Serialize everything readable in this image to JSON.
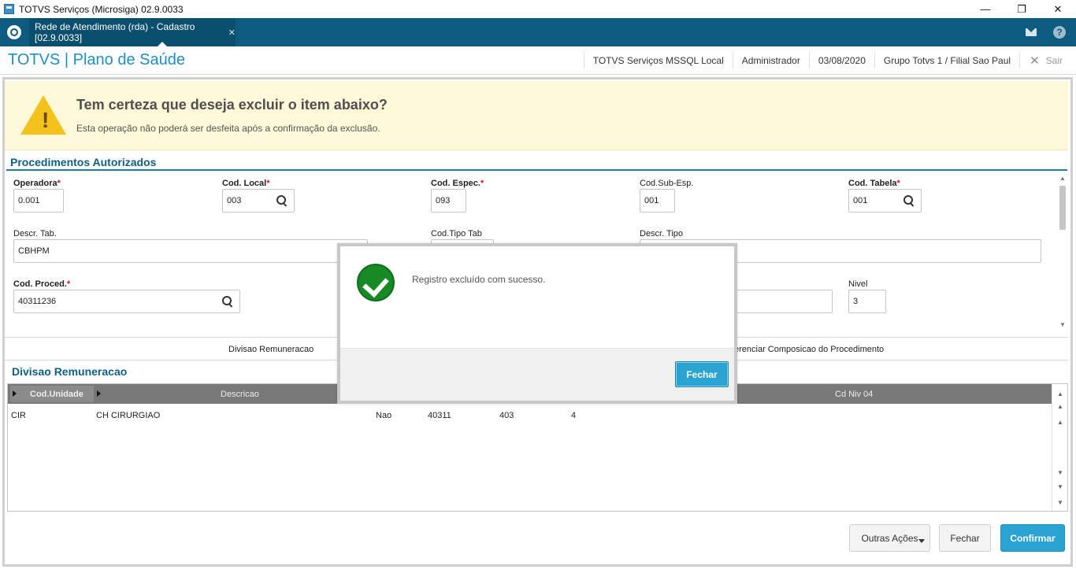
{
  "window": {
    "title": "TOTVS Serviços (Microsiga) 02.9.0033",
    "minimize": "—",
    "restore": "❐",
    "close": "✕"
  },
  "tabbar": {
    "tab_label": "Rede de Atendimento (rda) - Cadastro [02.9.0033]",
    "tab_close": "✕",
    "help": "?"
  },
  "header": {
    "brand": "TOTVS | Plano de Saúde",
    "server": "TOTVS Serviços MSSQL Local",
    "user": "Administrador",
    "date": "03/08/2020",
    "company": "Grupo Totvs 1 / Filial Sao Paul",
    "exit_label": "Sair"
  },
  "banner": {
    "title": "Tem certeza que deseja excluir o item abaixo?",
    "subtitle": "Esta operação não poderá ser desfeita após a confirmação da exclusão."
  },
  "form": {
    "section_title": "Procedimentos Autorizados",
    "fields": {
      "operadora": {
        "label": "Operadora",
        "value": "0.001"
      },
      "cod_local": {
        "label": "Cod. Local",
        "value": "003"
      },
      "cod_espec": {
        "label": "Cod. Espec.",
        "value": "093"
      },
      "cod_sub_esp": {
        "label": "Cod.Sub-Esp.",
        "value": "001"
      },
      "cod_tabela": {
        "label": "Cod. Tabela",
        "value": "001"
      },
      "descr_tab": {
        "label": "Descr. Tab.",
        "value": "CBHPM"
      },
      "cod_tipo_tab": {
        "label": "Cod.Tipo Tab",
        "value": ""
      },
      "descr_tipo": {
        "label": "Descr. Tipo",
        "value": ""
      },
      "cod_proced": {
        "label": "Cod. Proced.",
        "value": "40311236"
      },
      "nivel": {
        "label": "Nivel",
        "value": "3"
      }
    },
    "required_mark": "*"
  },
  "subtabs": {
    "divisao": "Divisao Remuneracao",
    "gerenciar": "erenciar Composicao do Procedimento"
  },
  "grid": {
    "title": "Divisao Remuneracao",
    "columns": [
      "Cod.Unidade",
      "Descricao",
      "Cd Niv 04"
    ],
    "rows": [
      {
        "unidade": "CIR",
        "descricao": "CH CIRURGIAO",
        "flag": "Nao",
        "c1": "40311",
        "c2": "403",
        "c3": "4"
      }
    ]
  },
  "footer": {
    "outras_acoes": "Outras Ações",
    "fechar": "Fechar",
    "confirmar": "Confirmar"
  },
  "modal": {
    "message": "Registro excluído com sucesso.",
    "button": "Fechar"
  },
  "colors": {
    "brand_blue": "#1d8fc0",
    "tabbar": "#0d5c80",
    "accent_button": "#29a3cf",
    "success_green": "#178a25",
    "warning_yellow": "#f4c21c",
    "banner_bg": "#fcf8d8"
  }
}
